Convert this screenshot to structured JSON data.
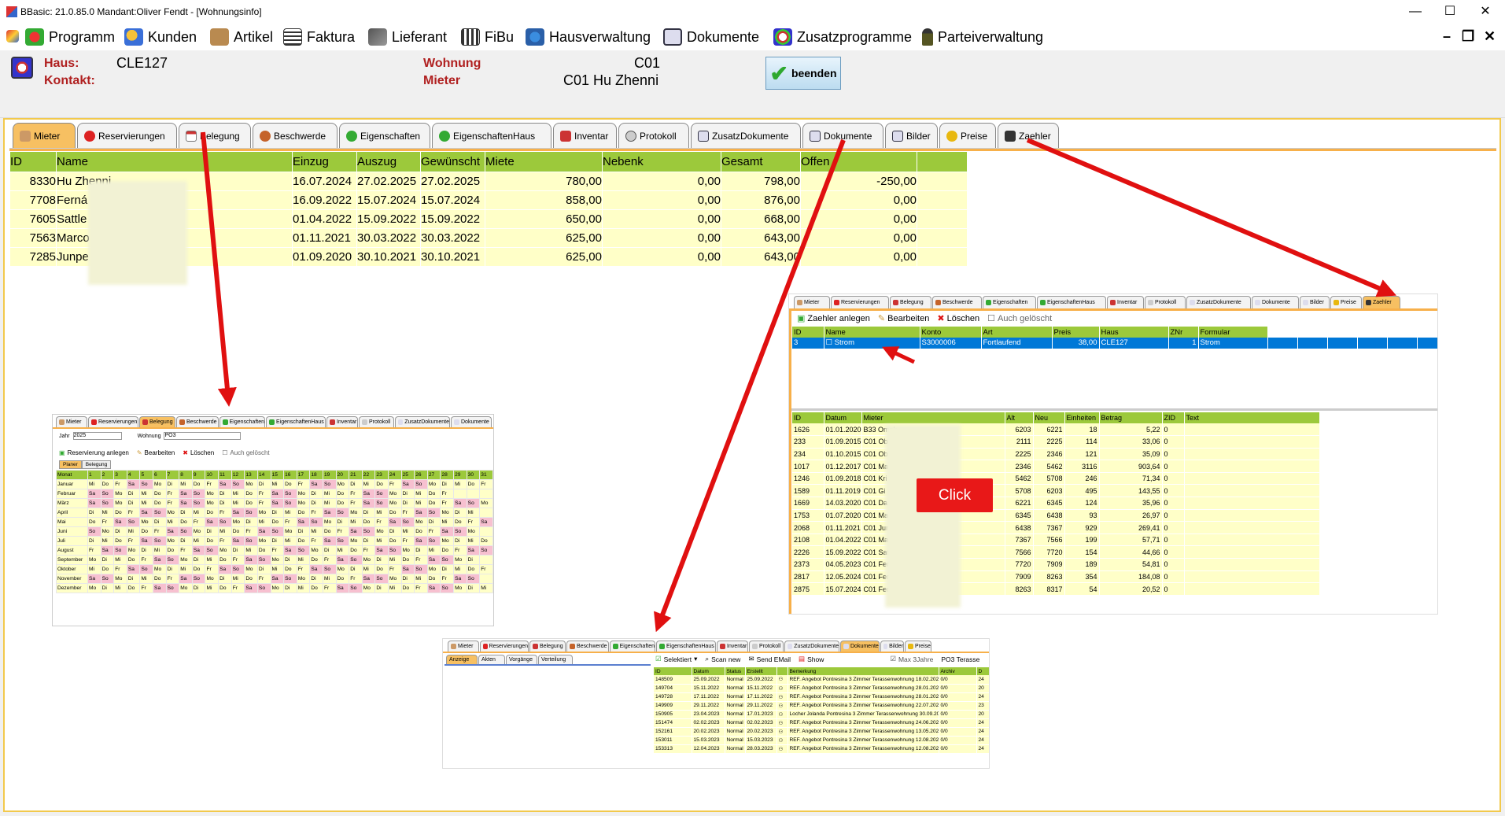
{
  "window": {
    "title": "BBasic: 21.0.85.0 Mandant:Oliver Fendt  - [Wohnungsinfo]",
    "min": "—",
    "max": "☐",
    "close": "✕"
  },
  "menu": {
    "items": [
      "Programm",
      "Kunden",
      "Artikel",
      "Faktura",
      "Lieferant",
      "FiBu",
      "Hausverwaltung",
      "Dokumente",
      "Zusatzprogramme",
      "Parteiverwaltung"
    ],
    "mdi_min": "–",
    "mdi_restore": "❐",
    "mdi_close": "✕"
  },
  "header": {
    "haus_label": "Haus:",
    "haus_value": "CLE127",
    "kontakt_label": "Kontakt:",
    "wohnung_label": "Wohnung",
    "wohnung_value": "C01",
    "mieter_label": "Mieter",
    "mieter_value": "C01 Hu Zhenni",
    "beenden": "beenden"
  },
  "tabs": [
    "Mieter",
    "Reservierungen",
    "Belegung",
    "Beschwerde",
    "Eigenschaften",
    "EigenschaftenHaus",
    "Inventar",
    "Protokoll",
    "ZusatzDokumente",
    "Dokumente",
    "Bilder",
    "Preise",
    "Zaehler"
  ],
  "mieter_table": {
    "headers": [
      "ID",
      "Name",
      "Einzug",
      "Auszug",
      "Gewünscht",
      "Miete",
      "Nebenk",
      "Gesamt",
      "Offen"
    ],
    "rows": [
      [
        "8330",
        "Hu Zhenni",
        "16.07.2024",
        "27.02.2025",
        "27.02.2025",
        "780,00",
        "0,00",
        "798,00",
        "-250,00"
      ],
      [
        "7708",
        "Ferná",
        "16.09.2022",
        "15.07.2024",
        "15.07.2024",
        "858,00",
        "0,00",
        "876,00",
        "0,00"
      ],
      [
        "7605",
        "Sattle",
        "01.04.2022",
        "15.09.2022",
        "15.09.2022",
        "650,00",
        "0,00",
        "668,00",
        "0,00"
      ],
      [
        "7563",
        "Marco",
        "01.11.2021",
        "30.03.2022",
        "30.03.2022",
        "625,00",
        "0,00",
        "643,00",
        "0,00"
      ],
      [
        "7285",
        "Junpe",
        "01.09.2020",
        "30.10.2021",
        "30.10.2021",
        "625,00",
        "0,00",
        "643,00",
        "0,00"
      ]
    ]
  },
  "zaehler": {
    "toolbar": [
      "Zaehler anlegen",
      "Bearbeiten",
      "Löschen",
      "Auch gelöscht"
    ],
    "headers": [
      "ID",
      "Name",
      "Konto",
      "Art",
      "Preis",
      "Haus",
      "ZNr",
      "Formular"
    ],
    "row": [
      "3",
      "Strom",
      "S3000006",
      "Fortlaufend",
      "38,00",
      "CLE127",
      "1",
      "Strom"
    ],
    "click": "Click",
    "reading_headers": [
      "ID",
      "Datum",
      "Mieter",
      "Alt",
      "Neu",
      "Einheiten",
      "Betrag",
      "ZID",
      "Text"
    ],
    "readings": [
      [
        "1626",
        "01.01.2020",
        "B33 Omnk",
        "6203",
        "6221",
        "18",
        "5,22",
        "0"
      ],
      [
        "233",
        "01.09.2015",
        "C01 Ob",
        "2111",
        "2225",
        "114",
        "33,06",
        "0"
      ],
      [
        "234",
        "01.10.2015",
        "C01 Ob",
        "2225",
        "2346",
        "121",
        "35,09",
        "0"
      ],
      [
        "1017",
        "01.12.2017",
        "C01 Ma",
        "2346",
        "5462",
        "3116",
        "903,64",
        "0"
      ],
      [
        "1246",
        "01.09.2018",
        "C01 Kri",
        "5462",
        "5708",
        "246",
        "71,34",
        "0"
      ],
      [
        "1589",
        "01.11.2019",
        "C01 Gi",
        "5708",
        "6203",
        "495",
        "143,55",
        "0"
      ],
      [
        "1669",
        "14.03.2020",
        "C01 Da",
        "6221",
        "6345",
        "124",
        "35,96",
        "0"
      ],
      [
        "1753",
        "01.07.2020",
        "C01 Ma",
        "6345",
        "6438",
        "93",
        "26,97",
        "0"
      ],
      [
        "2068",
        "01.11.2021",
        "C01 Jur",
        "6438",
        "7367",
        "929",
        "269,41",
        "0"
      ],
      [
        "2108",
        "01.04.2022",
        "C01 Ma",
        "7367",
        "7566",
        "199",
        "57,71",
        "0"
      ],
      [
        "2226",
        "15.09.2022",
        "C01 Sat",
        "7566",
        "7720",
        "154",
        "44,66",
        "0"
      ],
      [
        "2373",
        "04.05.2023",
        "C01 Fer",
        "7720",
        "7909",
        "189",
        "54,81",
        "0"
      ],
      [
        "2817",
        "12.05.2024",
        "C01 Fer",
        "7909",
        "8263",
        "354",
        "184,08",
        "0"
      ],
      [
        "2875",
        "15.07.2024",
        "C01 Fer",
        "8263",
        "8317",
        "54",
        "20,52",
        "0"
      ]
    ]
  },
  "belegung": {
    "jahr_label": "Jahr",
    "jahr_value": "2025",
    "wohnung_label": "Wohnung",
    "wohnung_value": "PO3",
    "toolbar": [
      "Reservierung anlegen",
      "Bearbeiten",
      "Löschen",
      "Auch gelöscht"
    ],
    "subtabs": [
      "Planer",
      "Belegung"
    ],
    "month_header": "Monat",
    "months": [
      "Januar",
      "Februar",
      "März",
      "April",
      "Mai",
      "Juni",
      "Juli",
      "August",
      "September",
      "Oktober",
      "November",
      "Dezember"
    ]
  },
  "dokumente": {
    "left_tabs": [
      "Anzeige",
      "Akten",
      "Vorgänge",
      "Verteilung"
    ],
    "toolbar": [
      "Selektiert",
      "Scan new",
      "Send EMail",
      "Show",
      "Max 3Jahre",
      "PO3 Terasse"
    ],
    "headers": [
      "ID",
      "Datum",
      "Status",
      "Erstellt",
      "",
      "Bemerkung",
      "Archiv",
      "D"
    ],
    "rows": [
      [
        "148509",
        "25.09.2022",
        "Normal",
        "25.09.2022",
        "REF. Angebot Pontresina 3 Zimmer Terassenwohnung 18.02.202...",
        "0/0",
        "24"
      ],
      [
        "149704",
        "15.11.2022",
        "Normal",
        "15.11.2022",
        "REF. Angebot Pontresina 3 Zimmer Terassenwohnung 28.01.202...",
        "0/0",
        "20"
      ],
      [
        "149728",
        "17.11.2022",
        "Normal",
        "17.11.2022",
        "REF. Angebot Pontresina 3 Zimmer Terassenwohnung 28.01.202...",
        "0/0",
        "24"
      ],
      [
        "149909",
        "29.11.2022",
        "Normal",
        "29.11.2022",
        "REF. Angebot Pontresina 3 Zimmer Terassenwohnung 22.07.202...",
        "0/0",
        "23"
      ],
      [
        "150905",
        "23.04.2023",
        "Normal",
        "17.01.2023",
        "Locher Jolanda Pontresina 3 Zimmer Terassenwohnung 30.09.202...",
        "0/0",
        "20"
      ],
      [
        "151474",
        "02.02.2023",
        "Normal",
        "02.02.2023",
        "REF. Angebot Pontresina 3 Zimmer Terassenwohnung 24.06.202...",
        "0/0",
        "24"
      ],
      [
        "152161",
        "20.02.2023",
        "Normal",
        "20.02.2023",
        "REF. Angebot Pontresina 3 Zimmer Terassenwohnung 13.05.202...",
        "0/0",
        "24"
      ],
      [
        "153011",
        "15.03.2023",
        "Normal",
        "15.03.2023",
        "REF. Angebot Pontresina 3 Zimmer Terassenwohnung 12.08.202...",
        "0/0",
        "24"
      ],
      [
        "153313",
        "12.04.2023",
        "Normal",
        "28.03.2023",
        "REF. Angebot Pontresina 3 Zimmer Terassenwohnung 12.08.202...",
        "0/0",
        "24"
      ]
    ]
  },
  "colors": {
    "accent_orange": "#f7c062",
    "grid_header": "#9cc93b",
    "grid_row": "#ffffc8",
    "arrow_red": "#e01010",
    "selection": "#0078d7"
  }
}
